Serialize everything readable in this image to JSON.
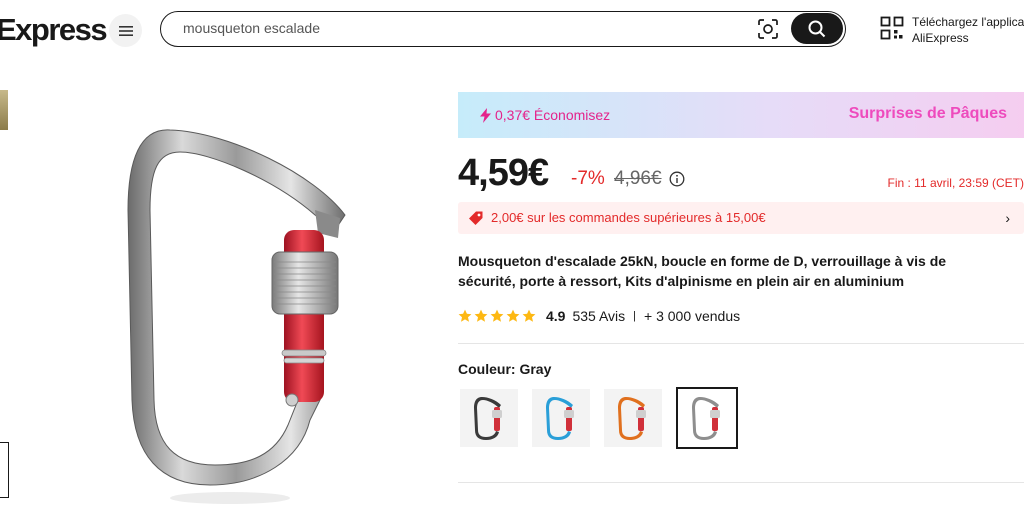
{
  "header": {
    "logo": "Express",
    "search": {
      "value": "mousqueton escalade",
      "placeholder": ""
    },
    "app_download_line1": "Téléchargez l'applica",
    "app_download_line2": "AliExpress"
  },
  "promo": {
    "savings": "0,37€ Économisez",
    "campaign": "Surprises de Pâques",
    "accent_color": "#e4238b"
  },
  "pricing": {
    "price": "4,59€",
    "discount": "-7%",
    "old_price": "4,96€",
    "end_time": "Fin :  11 avril, 23:59 (CET)"
  },
  "coupon": {
    "text": "2,00€ sur les commandes supérieures à 15,00€"
  },
  "product": {
    "title": "Mousqueton d'escalade 25kN, boucle en forme de D, verrouillage à vis de sécurité, porte à ressort, Kits d'alpinisme en plein air en aluminium",
    "rating": "4.9",
    "stars": 5,
    "reviews": "535 Avis",
    "separator": "|",
    "sold": "+ 3 000 vendus"
  },
  "color": {
    "label": "Couleur:",
    "selected": "Gray",
    "options": [
      {
        "name": "Black",
        "frame": "#3a3a3a",
        "gate": "#d0303a"
      },
      {
        "name": "Blue",
        "frame": "#2a9fd8",
        "gate": "#d0303a"
      },
      {
        "name": "Orange",
        "frame": "#e0701e",
        "gate": "#d0303a"
      },
      {
        "name": "Gray",
        "frame": "#8e8e8e",
        "gate": "#d0303a"
      }
    ]
  },
  "colors": {
    "price_red": "#e32a2a",
    "text": "#191919"
  }
}
